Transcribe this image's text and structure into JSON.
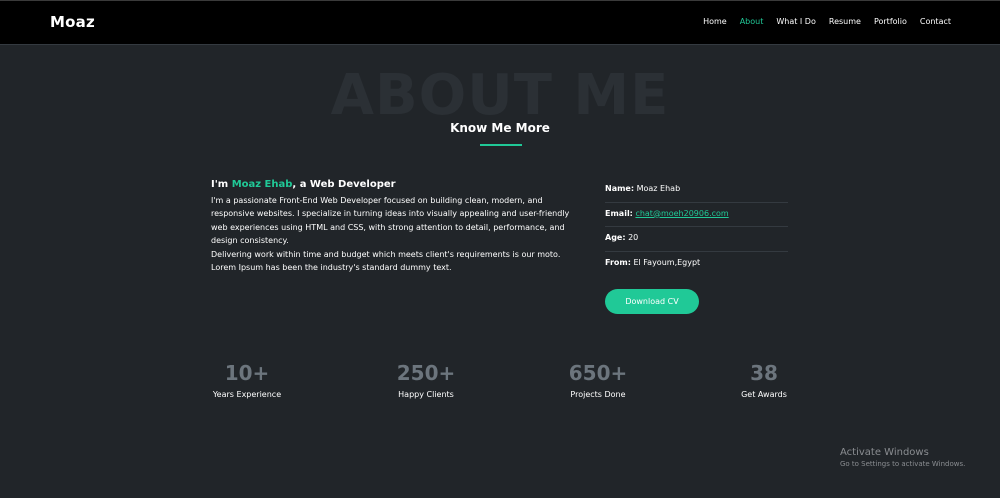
{
  "brand": "Moaz",
  "nav": {
    "items": [
      {
        "label": "Home"
      },
      {
        "label": "About"
      },
      {
        "label": "What I Do"
      },
      {
        "label": "Resume"
      },
      {
        "label": "Portfolio"
      },
      {
        "label": "Contact"
      }
    ],
    "active": "About"
  },
  "about": {
    "background_title": "ABOUT ME",
    "title": "Know Me More",
    "intro": {
      "prefix": "I'm ",
      "name": "Moaz Ehab",
      "suffix": ", a Web Developer"
    },
    "paragraphs": [
      "I'm a passionate Front-End Web Developer focused on building clean, modern, and responsive websites. I specialize in turning ideas into visually appealing and user-friendly web experiences using HTML and CSS, with strong attention to detail, performance, and design consistency.",
      "Delivering work within time and budget which meets client's requirements is our moto. Lorem Ipsum has been the industry's standard dummy text."
    ],
    "info": {
      "name_label": "Name:",
      "name_value": "Moaz Ehab",
      "email_label": "Email:",
      "email_value": "chat@moeh20906.com",
      "age_label": "Age:",
      "age_value": "20",
      "from_label": "From:",
      "from_value": "El Fayoum,Egypt"
    },
    "cv_button": "Download CV"
  },
  "stats": [
    {
      "value": "10+",
      "label": "Years Experience"
    },
    {
      "value": "250+",
      "label": "Happy Clients"
    },
    {
      "value": "650+",
      "label": "Projects Done"
    },
    {
      "value": "38",
      "label": "Get Awards"
    }
  ],
  "watermark": {
    "title": "Activate Windows",
    "subtitle": "Go to Settings to activate Windows."
  },
  "colors": {
    "accent": "#20c997",
    "background": "#212529",
    "navbar": "#000000",
    "stat_value": "#6c757d"
  }
}
